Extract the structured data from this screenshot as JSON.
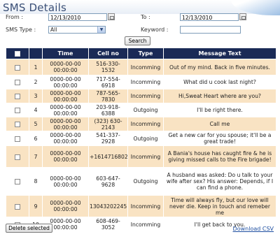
{
  "page": {
    "title": "SMS Details"
  },
  "filters": {
    "from_label": "From :",
    "from_value": "12/13/2010",
    "to_label": "To :",
    "to_value": "12/13/2010",
    "type_label": "SMS Type :",
    "type_value": "All",
    "keyword_label": "Keyword :",
    "keyword_value": "",
    "search_label": "Search"
  },
  "table": {
    "headers": [
      "",
      "",
      "Time",
      "Cell no",
      "Type",
      "Message Text"
    ],
    "rows": [
      {
        "n": "1",
        "time": "0000-00-00 00:00:00",
        "cell": "516-330-1532",
        "type": "Incomming",
        "msg": "Out of my mind. Back in five minutes."
      },
      {
        "n": "2",
        "time": "0000-00-00 00:00:00",
        "cell": "717-554-6918",
        "type": "Incomming",
        "msg": "What did u cook last night?"
      },
      {
        "n": "3",
        "time": "0000-00-00 00:00:00",
        "cell": "787-565-7830",
        "type": "Incomming",
        "msg": "Hi,Sweat Heart where are you?"
      },
      {
        "n": "4",
        "time": "0000-00-00 00:00:00",
        "cell": "203-918-6388",
        "type": "Outgoing",
        "msg": "I'll be right there."
      },
      {
        "n": "5",
        "time": "0000-00-00 00:00:00",
        "cell": "(323) 630-2143",
        "type": "Incomming",
        "msg": "Call me"
      },
      {
        "n": "6",
        "time": "0000-00-00 00:00:00",
        "cell": "541-337-2928",
        "type": "Outgoing",
        "msg": "Get a new car for you spouse; it'll be a great trade!"
      },
      {
        "n": "7",
        "time": "0000-00-00 00:00:00",
        "cell": "+16147168027",
        "type": "Incomming",
        "msg": "A Bania's house has caught fire & he is giving missed calls to the Fire brigade!"
      },
      {
        "n": "8",
        "time": "0000-00-00 00:00:00",
        "cell": "603-647-9628",
        "type": "Outgoing",
        "msg": "A husband was asked: Do u talk to your wife after sex? His answer: Depends, if I can find a phone."
      },
      {
        "n": "9",
        "time": "0000-00-00 00:00:00",
        "cell": "13043202245",
        "type": "Incomming",
        "msg": "Time will always fly, but our love will never die. Keep in touch and remeber me"
      },
      {
        "n": "10",
        "time": "0000-00-00 00:00:00",
        "cell": "608-469-3052",
        "type": "Incomming",
        "msg": "I'll get back to you."
      }
    ]
  },
  "footer": {
    "delete_label": "Delete selected",
    "download_label": "Download CSV"
  },
  "colors": {
    "header_bg": "#1a2a56",
    "odd_row": "#f9e3c3",
    "title": "#3a4f76",
    "link": "#1d4ea0"
  }
}
